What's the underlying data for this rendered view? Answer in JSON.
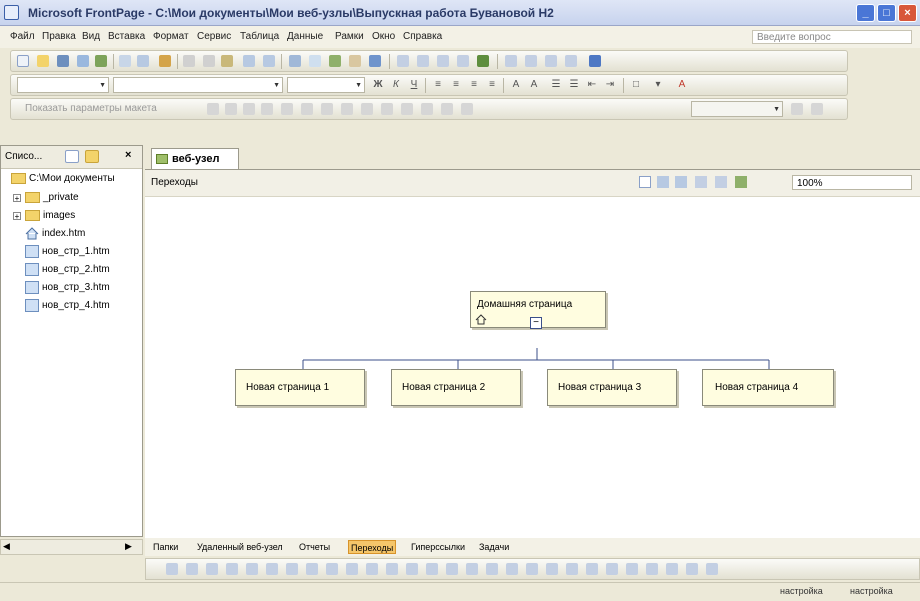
{
  "window": {
    "title": "Microsoft FrontPage - C:\\Мои документы\\Мои веб-узлы\\Выпускная работа Бувановой Н2"
  },
  "menu": {
    "items": [
      "Файл",
      "Правка",
      "Вид",
      "Вставка",
      "Формат",
      "Сервис",
      "Таблица",
      "Данные",
      "Рамки",
      "Окно",
      "Справка"
    ],
    "ask_placeholder": "Введите вопрос"
  },
  "toolbar3_faded_text": "Показать параметры макета",
  "folder_panel": {
    "header": "Списо...",
    "root": "C:\\Мои документы",
    "items": [
      {
        "label": "_private",
        "kind": "folder"
      },
      {
        "label": "images",
        "kind": "folder"
      },
      {
        "label": "index.htm",
        "kind": "home"
      },
      {
        "label": "нов_стр_1.htm",
        "kind": "page"
      },
      {
        "label": "нов_стр_2.htm",
        "kind": "page"
      },
      {
        "label": "нов_стр_3.htm",
        "kind": "page"
      },
      {
        "label": "нов_стр_4.htm",
        "kind": "page"
      }
    ]
  },
  "doc_tab": "веб-узел",
  "navigation": {
    "label": "Переходы",
    "zoom": "100%",
    "home_node": "Домашняя страница",
    "child_nodes": [
      "Новая страница 1",
      "Новая страница 2",
      "Новая страница 3",
      "Новая страница 4"
    ]
  },
  "view_tabs": [
    "Папки",
    "Удаленный веб-узел",
    "Отчеты",
    "Переходы",
    "Гиперссылки",
    "Задачи"
  ],
  "view_tab_active": "Переходы",
  "status": {
    "left": "настройка",
    "right": "настройка"
  }
}
